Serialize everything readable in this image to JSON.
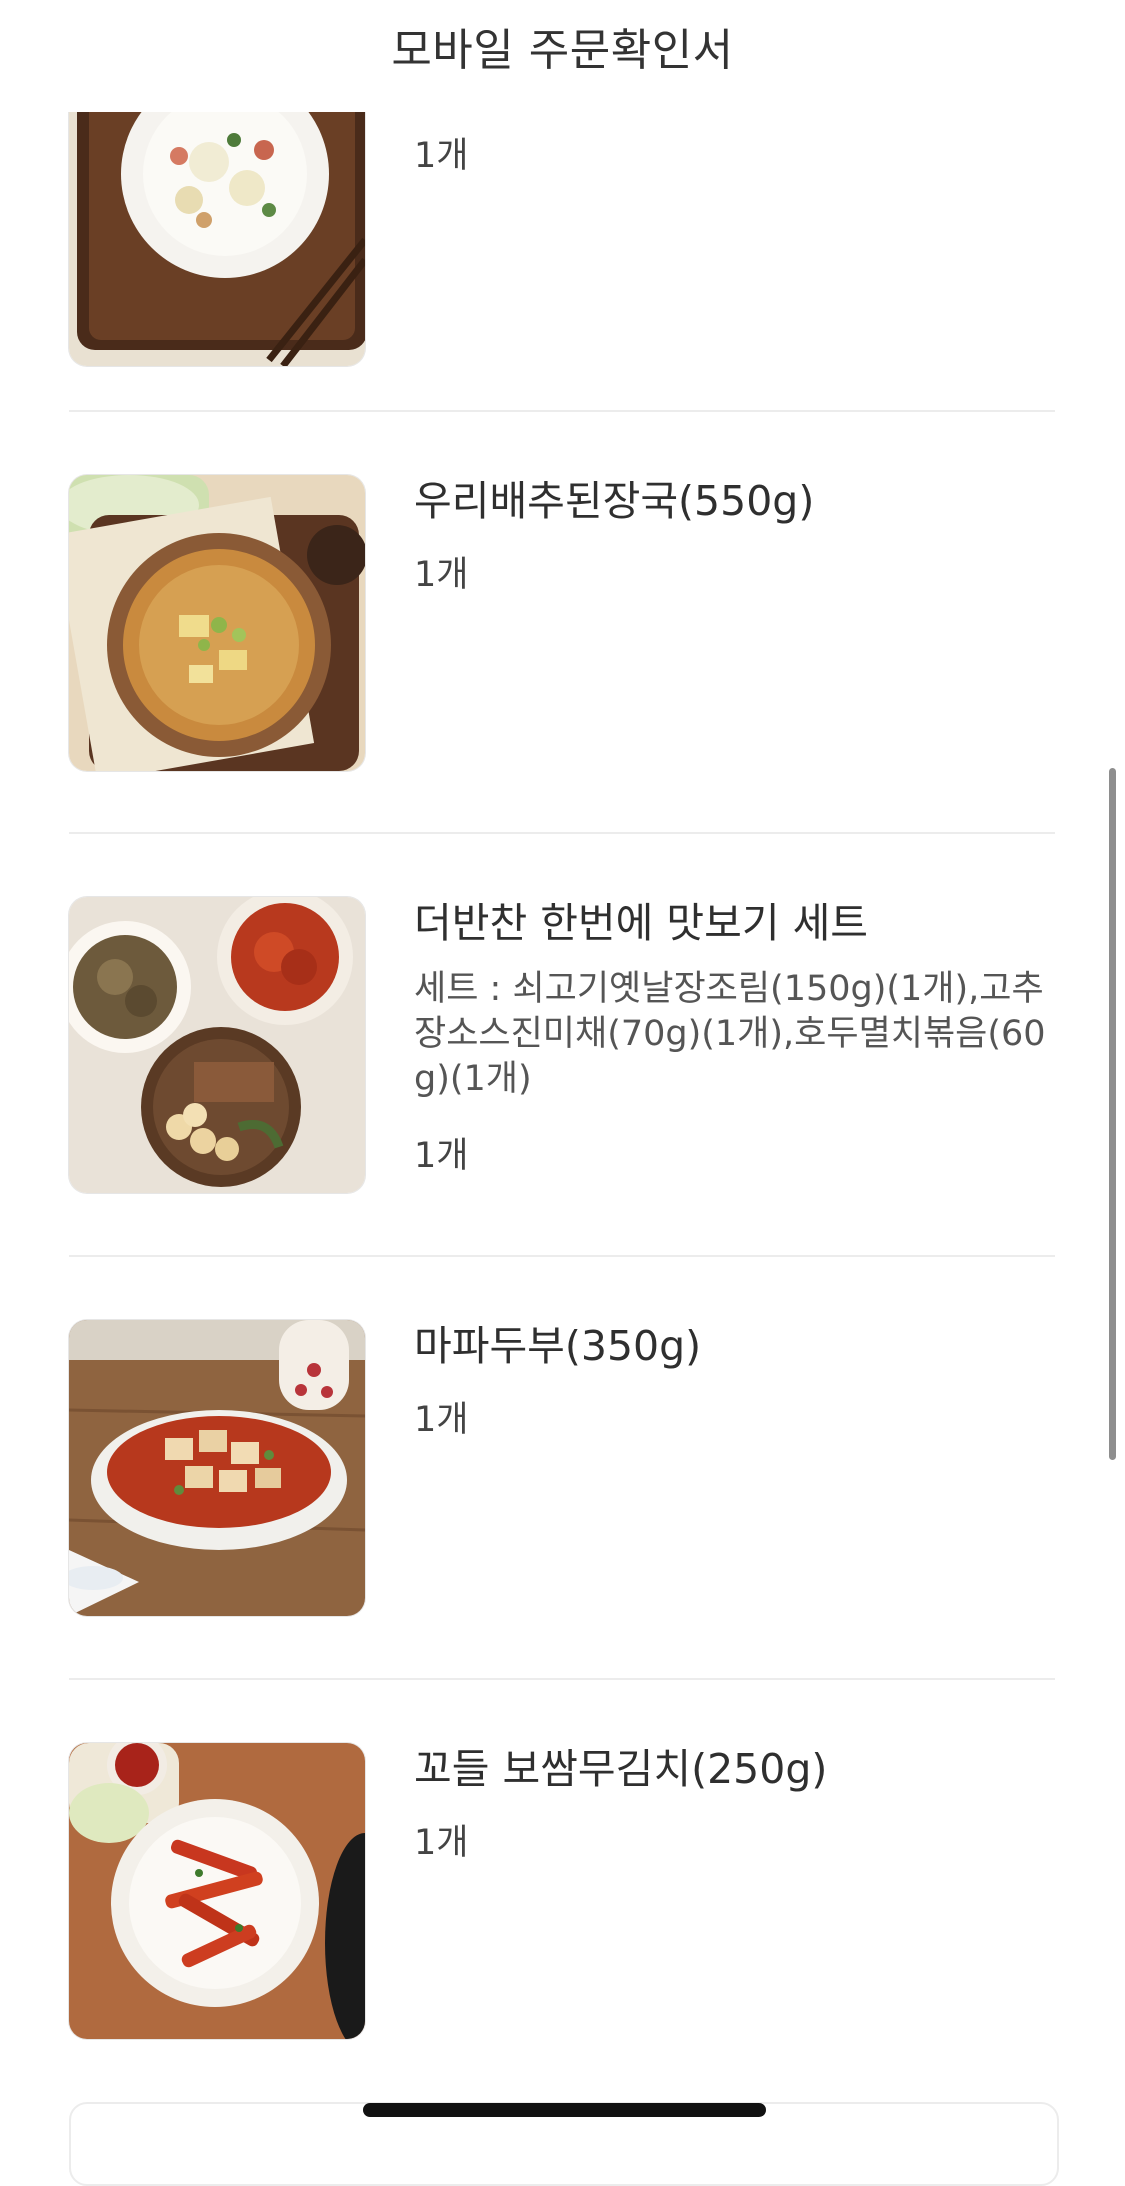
{
  "header": {
    "title": "모바일 주문확인서"
  },
  "items": [
    {
      "name": "",
      "options": "",
      "quantity": "1개",
      "image_icon": "potato-salad-image"
    },
    {
      "name": "우리배추된장국(550g)",
      "options": "",
      "quantity": "1개",
      "image_icon": "doenjang-soup-image"
    },
    {
      "name": "더반찬 한번에 맛보기 세트",
      "options": "세트 : 쇠고기옛날장조림(150g)(1개),고추장소스진미채(70g)(1개),호두멸치볶음(60g)(1개)",
      "quantity": "1개",
      "image_icon": "banchan-set-image"
    },
    {
      "name": "마파두부(350g)",
      "options": "",
      "quantity": "1개",
      "image_icon": "mapo-tofu-image"
    },
    {
      "name": "꼬들 보쌈무김치(250g)",
      "options": "",
      "quantity": "1개",
      "image_icon": "radish-kimchi-image"
    }
  ]
}
